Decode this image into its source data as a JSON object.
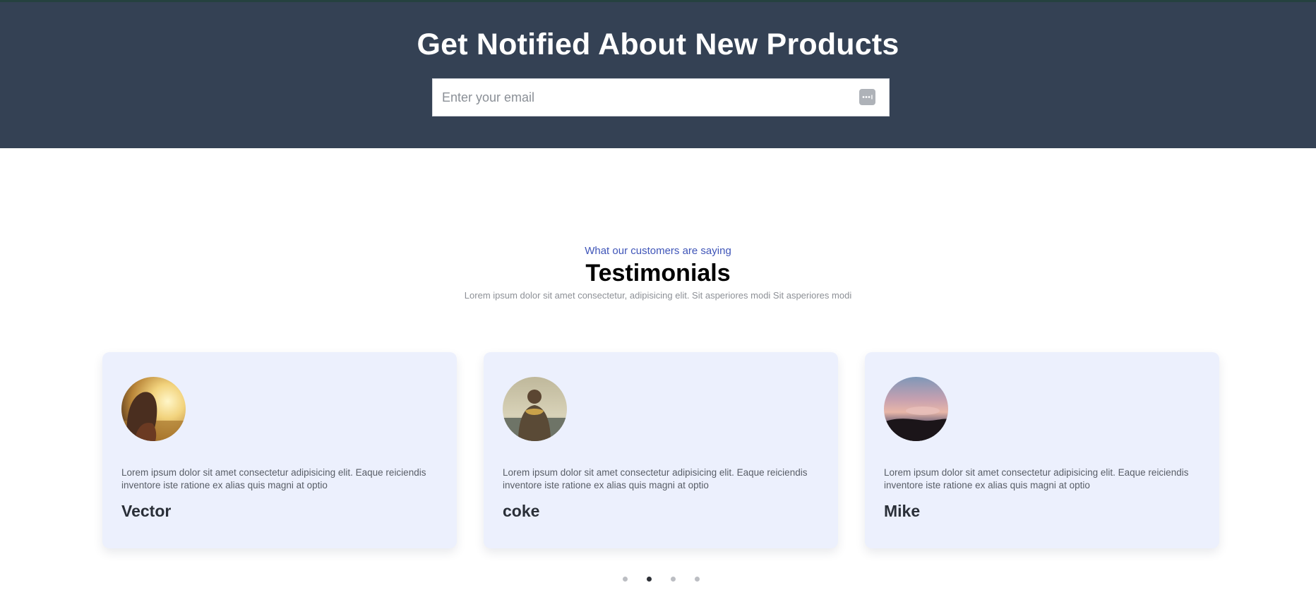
{
  "newsletter": {
    "title": "Get Notified About New Products",
    "email_placeholder": "Enter your email",
    "email_value": "",
    "background_color": "#344154"
  },
  "testimonials": {
    "eyebrow": "What our customers are saying",
    "title": "Testimonials",
    "subtitle": "Lorem ipsum dolor sit amet consectetur, adipisicing elit. Sit asperiores modi Sit asperiores modi",
    "cards": [
      {
        "name": "Vector",
        "text": "Lorem ipsum dolor sit amet consectetur adipisicing elit. Eaque reiciendis inventore iste ratione ex alias quis magni at optio"
      },
      {
        "name": "coke",
        "text": "Lorem ipsum dolor sit amet consectetur adipisicing elit. Eaque reiciendis inventore iste ratione ex alias quis magni at optio"
      },
      {
        "name": "Mike",
        "text": "Lorem ipsum dolor sit amet consectetur adipisicing elit. Eaque reiciendis inventore iste ratione ex alias quis magni at optio"
      }
    ],
    "card_color": "#ecf0fd",
    "accent_color": "#3f55b8"
  },
  "carousel": {
    "slide_count": 4,
    "active_slide": 2
  }
}
